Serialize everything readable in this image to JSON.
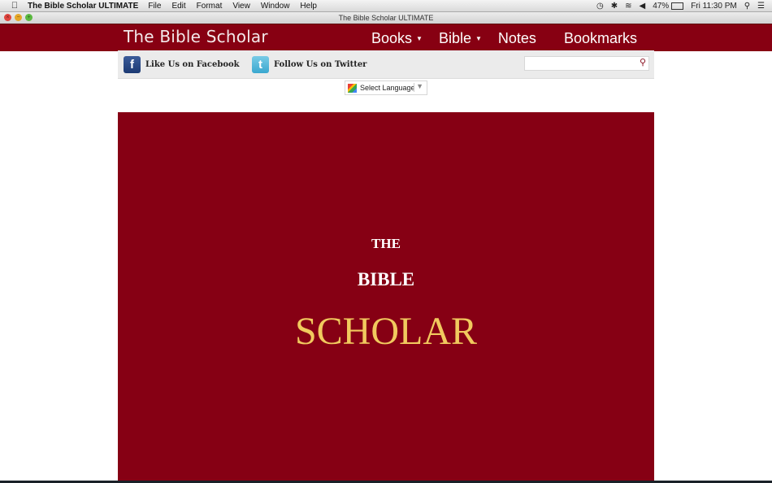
{
  "menubar": {
    "app_name": "The Bible Scholar ULTIMATE",
    "items": [
      "File",
      "Edit",
      "Format",
      "View",
      "Window",
      "Help"
    ],
    "status": {
      "battery": "47%",
      "clock": "Fri 11:30 PM"
    }
  },
  "window": {
    "title": "The Bible Scholar ULTIMATE"
  },
  "site": {
    "title": "The Bible Scholar",
    "nav": [
      {
        "label": "Books",
        "dropdown": true
      },
      {
        "label": "Bible",
        "dropdown": true
      },
      {
        "label": "Notes",
        "dropdown": false
      },
      {
        "label": "Bookmarks",
        "dropdown": false
      }
    ]
  },
  "social": {
    "facebook_label": "Like Us on Facebook",
    "twitter_label": "Follow Us on Twitter",
    "facebook_glyph": "f",
    "twitter_glyph": "t"
  },
  "search": {
    "value": "",
    "placeholder": ""
  },
  "language": {
    "selected": "Select Language"
  },
  "hero": {
    "line1": "THE",
    "line2": "BIBLE",
    "line3": "SCHOLAR"
  },
  "colors": {
    "brand_red": "#860014",
    "scholar_gold": "#f1c95e"
  }
}
